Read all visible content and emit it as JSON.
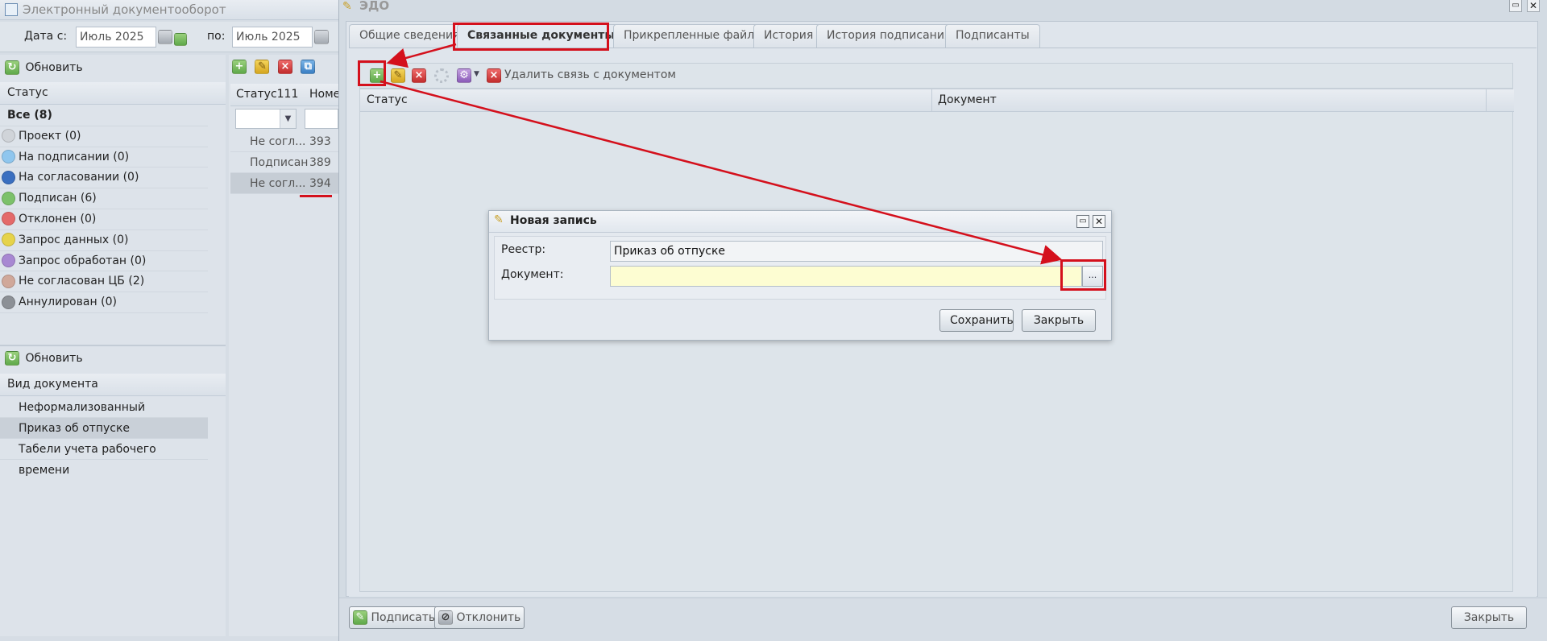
{
  "app": {
    "title": "Электронный документооборот"
  },
  "filter": {
    "date_from_label": "Дата с:",
    "date_from_value": "Июль 2025",
    "date_to_label": "по:",
    "date_to_value": "Июль 2025"
  },
  "status_panel": {
    "refresh": "Обновить",
    "header": "Статус",
    "items": [
      {
        "label": "Все (8)"
      },
      {
        "label": "Проект (0)",
        "color": "#d0d4d9"
      },
      {
        "label": "На подписании (0)",
        "color": "#8fc6ee"
      },
      {
        "label": "На согласовании (0)",
        "color": "#3a6fc0"
      },
      {
        "label": "Подписан (6)",
        "color": "#7cc16a"
      },
      {
        "label": "Отклонен (0)",
        "color": "#e46a6a"
      },
      {
        "label": "Запрос данных (0)",
        "color": "#e6d34a"
      },
      {
        "label": "Запрос обработан (0)",
        "color": "#a888d2"
      },
      {
        "label": "Не согласован ЦБ (2)",
        "color": "#d0a89a"
      },
      {
        "label": "Аннулирован (0)",
        "color": "#8c9096"
      }
    ]
  },
  "doctype_panel": {
    "refresh": "Обновить",
    "header": "Вид документа",
    "items": [
      "Неформализованный",
      "Приказ об отпуске",
      "Табели учета рабочего времени"
    ]
  },
  "grid": {
    "col_status": "Статус111",
    "col_number": "Номе",
    "rows": [
      {
        "status": "Не согл...",
        "number": "393"
      },
      {
        "status": "Подписан",
        "number": "389"
      },
      {
        "status": "Не согл...",
        "number": "394"
      }
    ]
  },
  "window": {
    "title": "ЭДО",
    "tabs": [
      "Общие сведения",
      "Связанные документы",
      "Прикрепленные файлы",
      "История",
      "История подписания",
      "Подписанты"
    ],
    "toolbar": {
      "remove_link": "Удалить связь с документом"
    },
    "columns": {
      "status": "Статус",
      "document": "Документ"
    },
    "footer": {
      "sign": "Подписать",
      "reject": "Отклонить",
      "close": "Закрыть"
    }
  },
  "dialog": {
    "title": "Новая запись",
    "registry_label": "Реестр:",
    "registry_value": "Приказ об отпуске",
    "document_label": "Документ:",
    "document_value": "",
    "browse": "...",
    "save": "Сохранить",
    "close": "Закрыть"
  },
  "colors": {
    "annotation": "#d4101c",
    "accent": "#3a6fc0"
  }
}
